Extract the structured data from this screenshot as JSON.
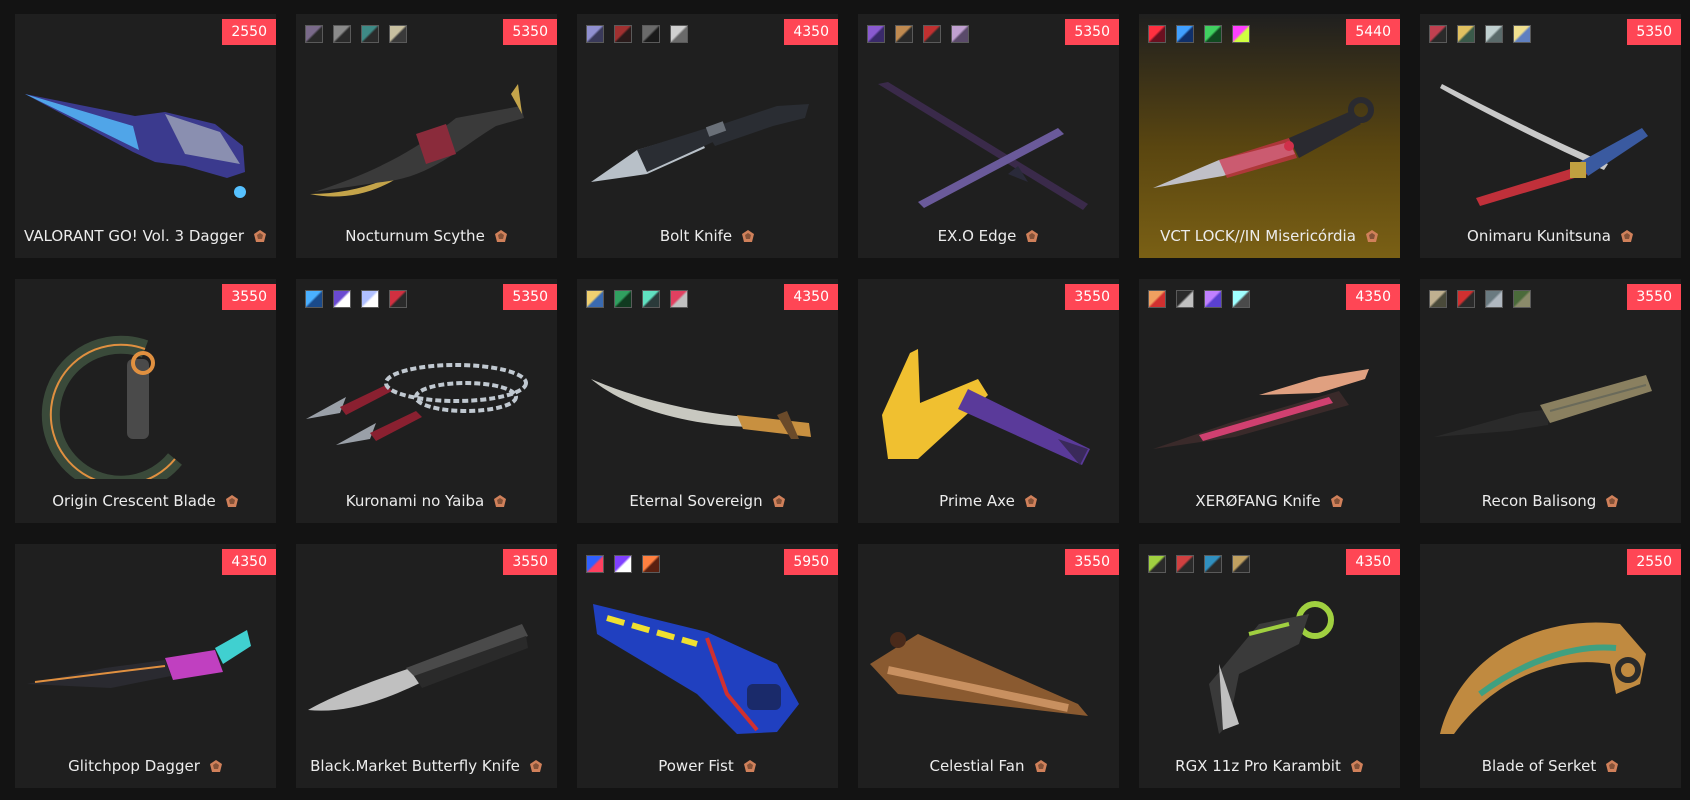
{
  "colors": {
    "price_badge": "#ff4655",
    "card_bg": "#1f1f1f",
    "page_bg": "#131313",
    "tier_icon": "#d0805a"
  },
  "items": [
    {
      "name": "VALORANT GO! Vol. 3 Dagger",
      "price": "2550",
      "swatches": [],
      "art": "dagger",
      "c1": "#3b3a8e",
      "c2": "#56c1ff",
      "c3": "#8a8fb0"
    },
    {
      "name": "Nocturnum Scythe",
      "price": "5350",
      "swatches": [
        [
          "#7a6a8a",
          "#2a2a2a"
        ],
        [
          "#8a8a8a",
          "#2a2a2a"
        ],
        [
          "#3e8a86",
          "#2a2a2a"
        ],
        [
          "#c8c0a0",
          "#3a3a3a"
        ]
      ],
      "art": "scythe",
      "c1": "#3a3a3a",
      "c2": "#c4a44a",
      "c3": "#8a2b3b"
    },
    {
      "name": "Bolt Knife",
      "price": "4350",
      "swatches": [
        [
          "#9090d0",
          "#3a3a5a"
        ],
        [
          "#a03030",
          "#2a1a1a"
        ],
        [
          "#6a6a6a",
          "#1a1a1a"
        ],
        [
          "#d0d0d0",
          "#6a6a6a"
        ]
      ],
      "art": "tanto",
      "c1": "#2a2d33",
      "c2": "#b8c0c8",
      "c3": "#6a7078"
    },
    {
      "name": "EX.O Edge",
      "price": "5350",
      "swatches": [
        [
          "#8a5ad0",
          "#3a2a6a"
        ],
        [
          "#c08a50",
          "#2a2a2a"
        ],
        [
          "#c03030",
          "#2a2a2a"
        ],
        [
          "#c0a0d0",
          "#5a4a6a"
        ]
      ],
      "art": "xswords",
      "c1": "#3a2a4a",
      "c2": "#6a5a9a",
      "c3": "#2a2a3a"
    },
    {
      "name": "VCT LOCK//IN Misericórdia",
      "price": "5440",
      "swatches": [
        [
          "#ff3040",
          "#6a1020"
        ],
        [
          "#40a0ff",
          "#10306a"
        ],
        [
          "#40d060",
          "#104a20"
        ],
        [
          "#ff40ff",
          "#d0ff40"
        ]
      ],
      "art": "misericordia",
      "c1": "#2a2a30",
      "c2": "#d0304a",
      "c3": "#c0c0c8",
      "featured": true
    },
    {
      "name": "Onimaru Kunitsuna",
      "price": "5350",
      "swatches": [
        [
          "#c04050",
          "#2a2a2a"
        ],
        [
          "#e0c060",
          "#3a5a4a"
        ],
        [
          "#c0d0d0",
          "#5a6a6a"
        ],
        [
          "#f0e090",
          "#6080c0"
        ]
      ],
      "art": "katana",
      "c1": "#c8c8c8",
      "c2": "#c0303a",
      "c3": "#3a5aa0"
    },
    {
      "name": "Origin Crescent Blade",
      "price": "3550",
      "swatches": [],
      "art": "crescent",
      "c1": "#3a4a3a",
      "c2": "#e09040",
      "c3": "#4a4a4a"
    },
    {
      "name": "Kuronami no Yaiba",
      "price": "5350",
      "swatches": [
        [
          "#4ab0ff",
          "#1a4a8a"
        ],
        [
          "#6a4ad0",
          "#ffffff"
        ],
        [
          "#b0c0ff",
          "#ffffff"
        ],
        [
          "#d03040",
          "#2a2a2a"
        ]
      ],
      "art": "kunai",
      "c1": "#9aa0a8",
      "c2": "#8a2030",
      "c3": "#c0c8d0"
    },
    {
      "name": "Eternal Sovereign",
      "price": "4350",
      "swatches": [
        [
          "#f0d070",
          "#3a6ab0"
        ],
        [
          "#30a060",
          "#103a20"
        ],
        [
          "#60e0c0",
          "#2a3a3a"
        ],
        [
          "#e04060",
          "#c0c0c0"
        ]
      ],
      "art": "sovereign",
      "c1": "#c8c8c0",
      "c2": "#c89040",
      "c3": "#6a4a2a"
    },
    {
      "name": "Prime Axe",
      "price": "3550",
      "swatches": [],
      "art": "axe",
      "c1": "#f0c030",
      "c2": "#5a3a9a",
      "c3": "#3a2a5a"
    },
    {
      "name": "XERØFANG Knife",
      "price": "4350",
      "swatches": [
        [
          "#f0a060",
          "#d03030"
        ],
        [
          "#2a2a2a",
          "#c0c0c0"
        ],
        [
          "#c080ff",
          "#5a40d0"
        ],
        [
          "#a0ffff",
          "#4a4a4a"
        ]
      ],
      "art": "xerofang",
      "c1": "#3a2a2a",
      "c2": "#e0a080",
      "c3": "#d04070"
    },
    {
      "name": "Recon Balisong",
      "price": "3550",
      "swatches": [
        [
          "#c0b090",
          "#4a4a3a"
        ],
        [
          "#d03030",
          "#2a2a2a"
        ],
        [
          "#6a7a80",
          "#b0b8c0"
        ],
        [
          "#4a6a3a",
          "#8a8a6a"
        ]
      ],
      "art": "balisong",
      "c1": "#8a8060",
      "c2": "#2a2a2a",
      "c3": "#6a6a5a"
    },
    {
      "name": "Glitchpop Dagger",
      "price": "4350",
      "swatches": [],
      "art": "glitch",
      "c1": "#2a2a30",
      "c2": "#c040c0",
      "c3": "#40d0d0"
    },
    {
      "name": "Black.Market Butterfly Knife",
      "price": "3550",
      "swatches": [],
      "art": "butterfly",
      "c1": "#4a4a4a",
      "c2": "#c0c0c0",
      "c3": "#2a2a2a"
    },
    {
      "name": "Power Fist",
      "price": "5950",
      "swatches": [
        [
          "#3060ff",
          "#ff4060"
        ],
        [
          "#8040ff",
          "#ffffff"
        ],
        [
          "#ff8040",
          "#5a2010"
        ]
      ],
      "art": "fist",
      "c1": "#2040c0",
      "c2": "#f0e030",
      "c3": "#d03030"
    },
    {
      "name": "Celestial Fan",
      "price": "3550",
      "swatches": [],
      "art": "fan",
      "c1": "#8a5a30",
      "c2": "#c89060",
      "c3": "#4a2a1a"
    },
    {
      "name": "RGX 11z Pro Karambit",
      "price": "4350",
      "swatches": [
        [
          "#a0d040",
          "#2a2a2a"
        ],
        [
          "#d04040",
          "#2a2a2a"
        ],
        [
          "#3090c0",
          "#2a2a2a"
        ],
        [
          "#c0a060",
          "#2a2a2a"
        ]
      ],
      "art": "karambit",
      "c1": "#3a3a3a",
      "c2": "#a0d040",
      "c3": "#c0c0c0"
    },
    {
      "name": "Blade of Serket",
      "price": "2550",
      "swatches": [],
      "art": "serket",
      "c1": "#c08a40",
      "c2": "#40a080",
      "c3": "#2a2a2a"
    }
  ]
}
